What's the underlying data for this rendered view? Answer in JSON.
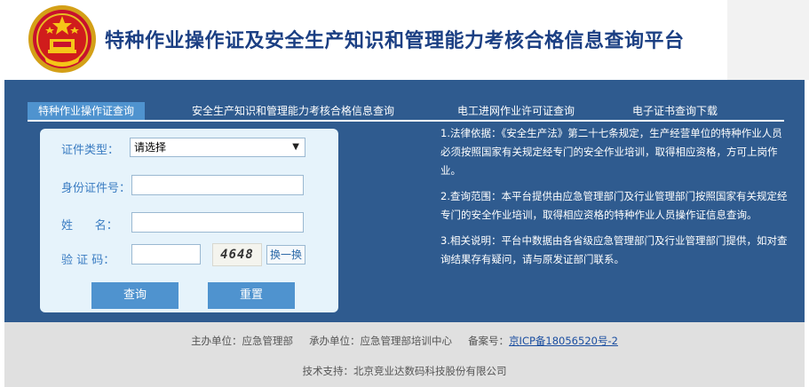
{
  "header": {
    "emblem_icon": "national-emblem-icon",
    "title": "特种作业操作证及安全生产知识和管理能力考核合格信息查询平台"
  },
  "tabs": [
    {
      "label": "特种作业操作证查询",
      "active": true
    },
    {
      "label": "安全生产知识和管理能力考核合格信息查询",
      "active": false
    },
    {
      "label": "电工进网作业许可证查询",
      "active": false
    },
    {
      "label": "电子证书查询下载",
      "active": false
    }
  ],
  "form": {
    "cert_type_label": "证件类型：",
    "cert_type_value": "请选择",
    "id_label": "身份证件号：",
    "id_value": "",
    "name_label": "姓      名：",
    "name_value": "",
    "captcha_label": "验 证 码：",
    "captcha_value": "",
    "captcha_text": "4648",
    "refresh_label": "换一换",
    "query_button": "查询",
    "reset_button": "重置"
  },
  "notes": [
    "1.法律依据：《安全生产法》第二十七条规定，生产经营单位的特种作业人员必须按照国家有关规定经专门的安全作业培训，取得相应资格，方可上岗作业。",
    "2.查询范围：本平台提供由应急管理部门及行业管理部门按照国家有关规定经专门的安全作业培训，取得相应资格的特种作业人员操作证信息查询。",
    "3.相关说明：平台中数据由各省级应急管理部门及行业管理部门提供，如对查询结果存有疑问，请与原发证部门联系。"
  ],
  "footer": {
    "host": "主办单位：应急管理部",
    "organizer": "承办单位：应急管理部培训中心",
    "icp_label": "备案号：",
    "icp_link": "京ICP备18056520号-2",
    "support": "技术支持：北京竞业达数码科技股份有限公司"
  },
  "colors": {
    "title": "#1b3f83",
    "main_bg": "#2f5b8f",
    "tab_active": "#4f93cf",
    "form_bg": "#e6f3fb",
    "button": "#4f93cf",
    "footer_bg": "#e0e0e0"
  }
}
